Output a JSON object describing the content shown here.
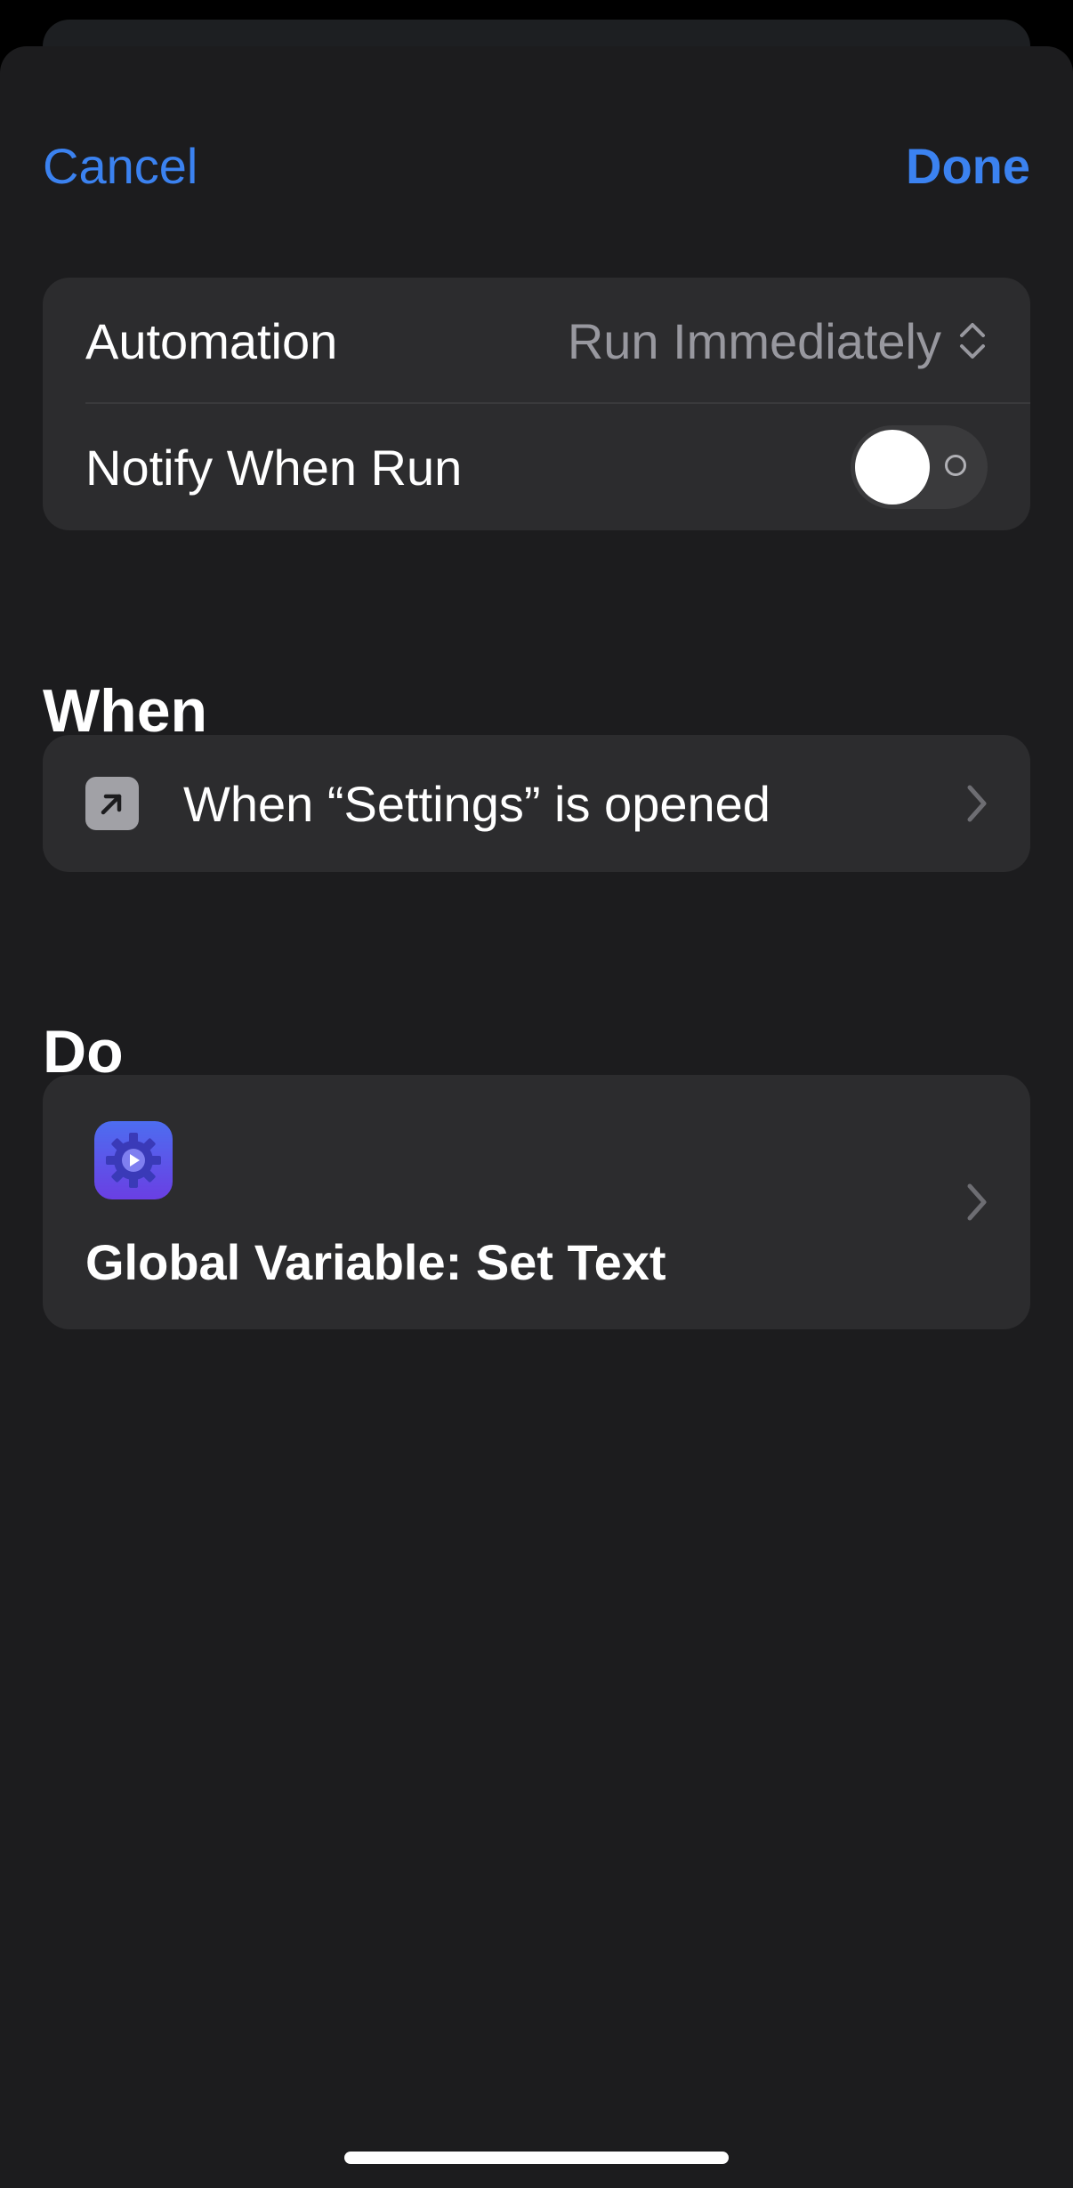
{
  "nav": {
    "cancel_label": "Cancel",
    "done_label": "Done"
  },
  "settings": {
    "automation_label": "Automation",
    "automation_value": "Run Immediately",
    "notify_label": "Notify When Run",
    "notify_enabled": false
  },
  "when": {
    "title": "When",
    "trigger_label": "When “Settings” is opened",
    "trigger_icon": "arrow-up-right-icon"
  },
  "do": {
    "title": "Do",
    "action_label": "Global Variable: Set Text",
    "action_icon": "gear-play-app-icon"
  },
  "colors": {
    "accent": "#3b82f0",
    "sheet_background": "#1c1c1e",
    "group_background": "#2c2c2e"
  }
}
